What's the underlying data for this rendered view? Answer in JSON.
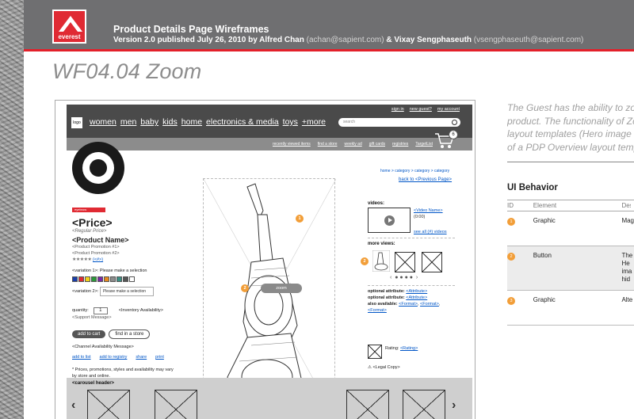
{
  "header": {
    "brand": "everest",
    "title": "Product Details Page Wireframes",
    "version_prefix": "Version ",
    "version": "2.0",
    "published_prefix": " published ",
    "date": "July 26, 2010",
    "by": " by ",
    "author1": "Alfred Chan",
    "author1_email": " (achan@sapient.com)",
    "amp": " & ",
    "author2": "Vixay Sengphaseuth",
    "author2_email": " (vsengphaseuth@sapient.com)"
  },
  "page_title": "WF04.04 Zoom",
  "wireframe": {
    "logo": "logo",
    "nav": [
      "women",
      "men",
      "baby",
      "kids",
      "home",
      "electronics & media",
      "toys",
      "+more"
    ],
    "utility_links": [
      "sign in",
      "new guest?",
      "my account"
    ],
    "search_placeholder": "search",
    "sub_links": [
      "recently viewed items",
      "find a store",
      "weekly ad",
      "gift cards",
      "registries",
      "TargetList"
    ],
    "cart_count": "6",
    "breadcrumb": "home > category > category > category",
    "back_link": "back to <Previous Page>",
    "badge": "eyebrow",
    "price": "<Price>",
    "regular_price": "<Regular Price>",
    "product_name": "<Product Name>",
    "promo1": "<Product Promotion #1>",
    "promo2": "<Product Promotion #2>",
    "rating_stars": "★★★★★",
    "rating_count": "(<#>)",
    "variation1_label": "<variation 1>:",
    "variation1_hint": " Please make a selection",
    "swatch_colors": [
      "#1a3faa",
      "#e02a33",
      "#f2d21a",
      "#2c9a3a",
      "#7a2aa8",
      "#e58a1e",
      "#8c8c8c",
      "#3b8f84",
      "#555555",
      "#ffffff"
    ],
    "variation2_label": "<variation 2>:",
    "variation2_select": "Please make a selection",
    "quantity_label": "quantity:",
    "quantity_value": "1",
    "inventory": "<Inventory Availability>",
    "support_message": "<Support Message>",
    "add_to_cart": "add to cart",
    "find_in_store": "find in a store",
    "channel_message": "<Channel Availability Message>",
    "actions": [
      "add to list",
      "add to registry",
      "share",
      "print"
    ],
    "disclaimer1": "* Prices, promotions, styles and availability may vary",
    "disclaimer2": "by store and online.",
    "zoom_label": "zoom",
    "videos_label": "videos:",
    "video_name": "<Video Name>",
    "video_time": "(0:00)",
    "see_all_videos": "see all (#) videos",
    "more_views_label": "more views:",
    "opt_attr_label": "optional attribute:",
    "opt_attr_value": "<Attribute>",
    "also_available_label": "also available:",
    "formats": [
      "<Format>",
      "<Format>",
      "<Format>"
    ],
    "rating_label": "Rating:",
    "rating_value": "<Rating>",
    "legal_copy": "<Legal Copy>",
    "carousel_header": "<carousel header>",
    "markers": [
      "1",
      "2",
      "3"
    ]
  },
  "side_panel": {
    "description": [
      "The Guest has the ability to zoom",
      "product. The functionality of Zoom",
      "layout templates (Hero image",
      "of a PDP Overview layout template"
    ],
    "ui_behavior_title": "UI Behavior",
    "columns": [
      "ID",
      "Element",
      "Description"
    ],
    "rows": [
      {
        "id": "1",
        "element": "Graphic",
        "desc": "Mag"
      },
      {
        "id": "2",
        "element": "Button",
        "desc": "The"
      },
      {
        "id": "3",
        "element": "Graphic",
        "desc": "Alte"
      }
    ],
    "row2_extra": [
      "He",
      "ima",
      "hid"
    ]
  }
}
